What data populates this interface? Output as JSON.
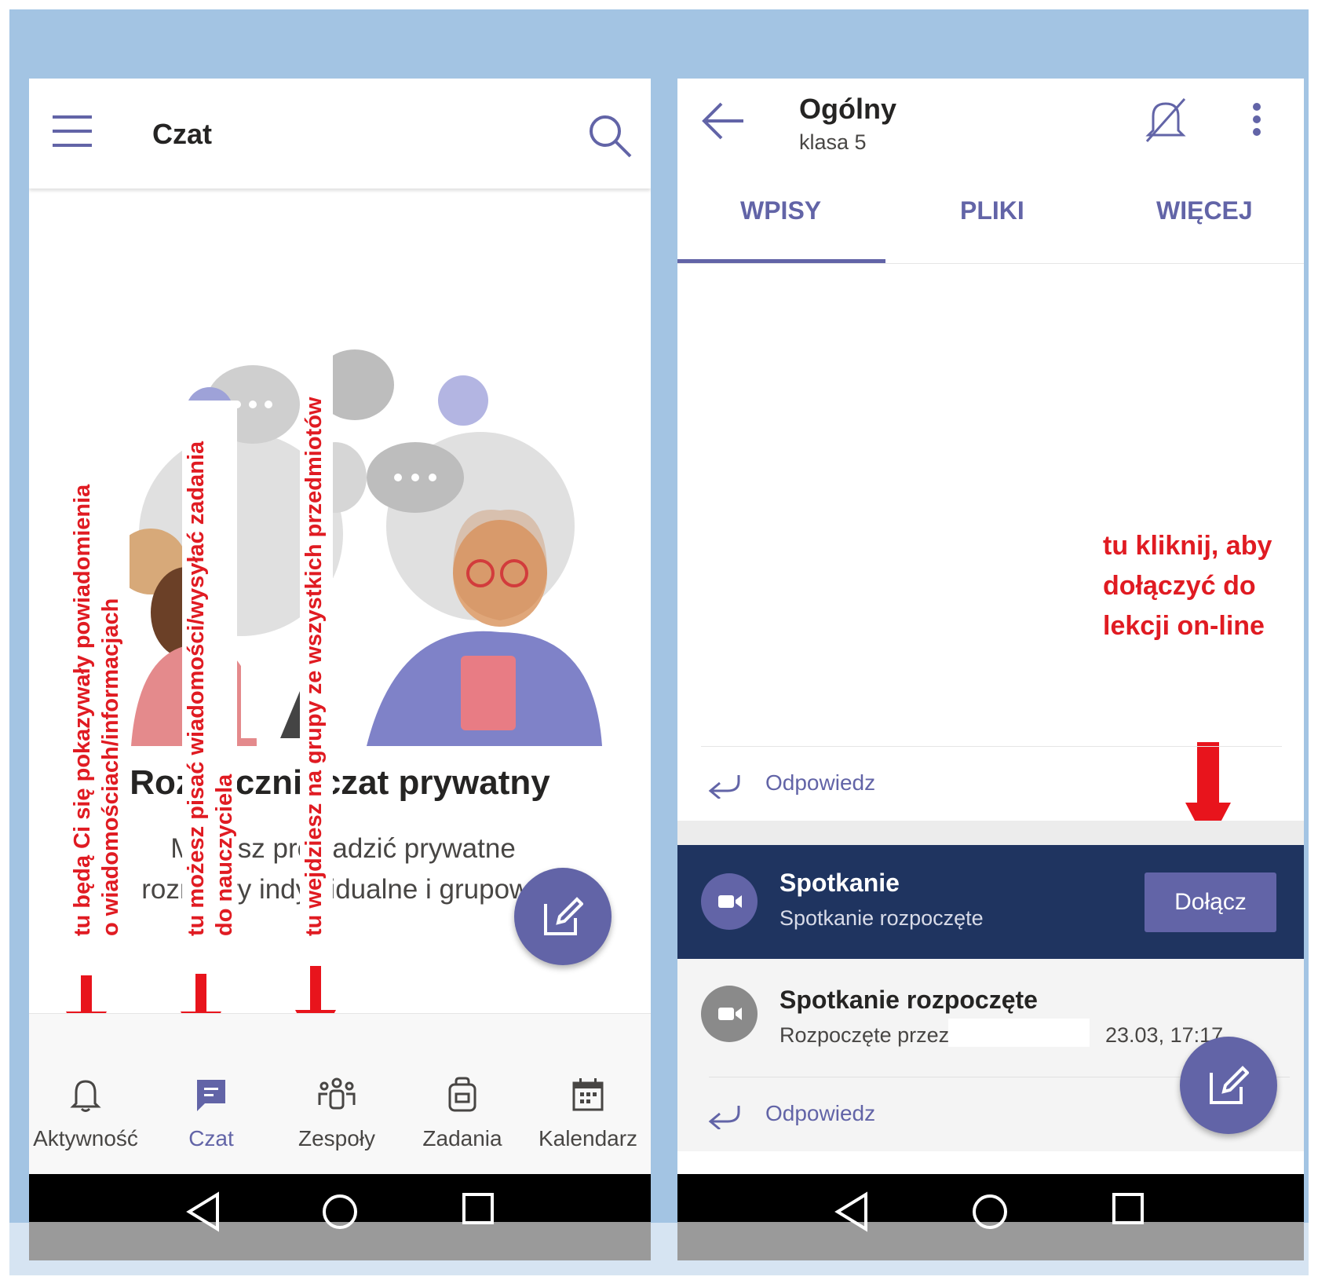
{
  "left": {
    "header": {
      "title": "Czat"
    },
    "empty_state": {
      "title": "Rozpocznij czat prywatny",
      "subtitle_line1": "Możesz prowadzić prywatne",
      "subtitle_line2": "rozmowy indywidualne i grupowe"
    },
    "nav": [
      {
        "label": "Aktywność",
        "icon": "bell-icon"
      },
      {
        "label": "Czat",
        "icon": "chat-icon",
        "active": true
      },
      {
        "label": "Zespoły",
        "icon": "teams-icon"
      },
      {
        "label": "Zadania",
        "icon": "assignments-icon"
      },
      {
        "label": "Kalendarz",
        "icon": "calendar-icon"
      }
    ],
    "annotations": {
      "activity_line1": "tu będą Ci się pokazywały powiadomienia",
      "activity_line2": "o wiadomościach/informacjach",
      "chat_line1": "tu możesz pisać wiadomości/wysyłać zadania",
      "chat_line2": "do nauczyciela",
      "teams_line1": "tu wejdziesz na grupy ze wszystkich przedmiotów"
    }
  },
  "right": {
    "header": {
      "title": "Ogólny",
      "subtitle": "klasa 5"
    },
    "tabs": [
      "WPISY",
      "PLIKI",
      "WIĘCEJ"
    ],
    "reply_label": "Odpowiedz",
    "meeting": {
      "title": "Spotkanie",
      "status": "Spotkanie rozpoczęte",
      "join_label": "Dołącz"
    },
    "post": {
      "title": "Spotkanie rozpoczęte",
      "started_by": "Rozpoczęte przez",
      "timestamp": "23.03, 17:17"
    },
    "annotation": {
      "line1": "tu kliknij, aby",
      "line2": "dołączyć do",
      "line3": "lekcji on-line"
    }
  },
  "colors": {
    "brand": "#6264a7",
    "annotation": "#e01b22",
    "meeting_banner": "#1f3460"
  }
}
